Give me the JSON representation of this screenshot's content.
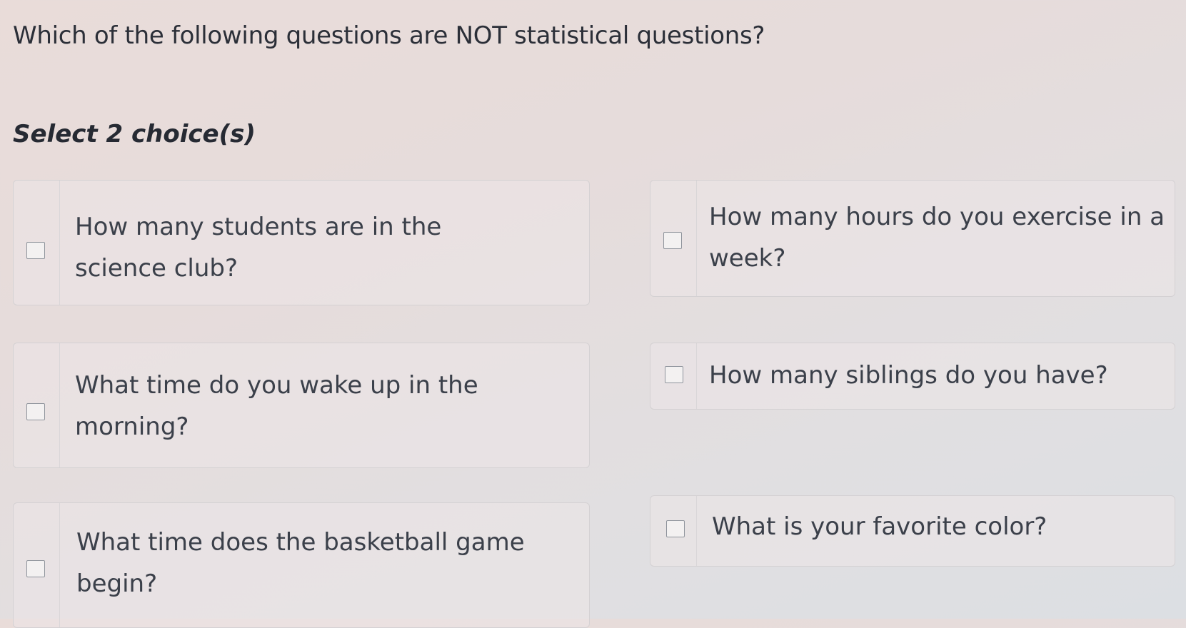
{
  "quiz": {
    "question": "Which of the following questions are NOT statistical questions?",
    "instruction": "Select 2 choice(s)",
    "choices": [
      {
        "label": "How many students are in the science club?",
        "checked": false
      },
      {
        "label": "How many hours do you exercise in a week?",
        "checked": false
      },
      {
        "label": "What time do you wake up in the morning?",
        "checked": false
      },
      {
        "label": "How many siblings do you have?",
        "checked": false
      },
      {
        "label": "What time does the basketball game begin?",
        "checked": false
      },
      {
        "label": "What is your favorite color?",
        "checked": false
      }
    ]
  }
}
